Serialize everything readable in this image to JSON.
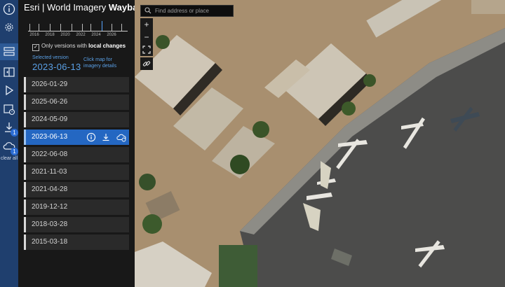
{
  "app": {
    "title_prefix": "Esri | World Imagery ",
    "title_bold": "Wayback"
  },
  "timeline": {
    "years": [
      "2016",
      "2018",
      "2020",
      "2022",
      "2024",
      "2026"
    ]
  },
  "filter": {
    "checked": true,
    "label_pre": "Only versions with ",
    "label_em": "local changes"
  },
  "selected": {
    "label": "Selected version",
    "date": "2023-06-13",
    "hint": "Click map for imagery details"
  },
  "versions": [
    {
      "date": "2026-01-29"
    },
    {
      "date": "2025-06-26"
    },
    {
      "date": "2024-05-09"
    },
    {
      "date": "2023-06-13"
    },
    {
      "date": "2022-06-08"
    },
    {
      "date": "2021-11-03"
    },
    {
      "date": "2021-04-28"
    },
    {
      "date": "2019-12-12"
    },
    {
      "date": "2018-03-28"
    },
    {
      "date": "2015-03-18"
    }
  ],
  "rail": {
    "download_badge": "1",
    "saved_badge": "1",
    "clear_label": "clear all"
  },
  "search": {
    "placeholder": "Find address or place"
  },
  "map_tools": {
    "zoom_in": "+",
    "zoom_out": "−"
  },
  "colors": {
    "accent": "#2467c2",
    "rail": "#1f3f6e",
    "panel": "#181818"
  }
}
